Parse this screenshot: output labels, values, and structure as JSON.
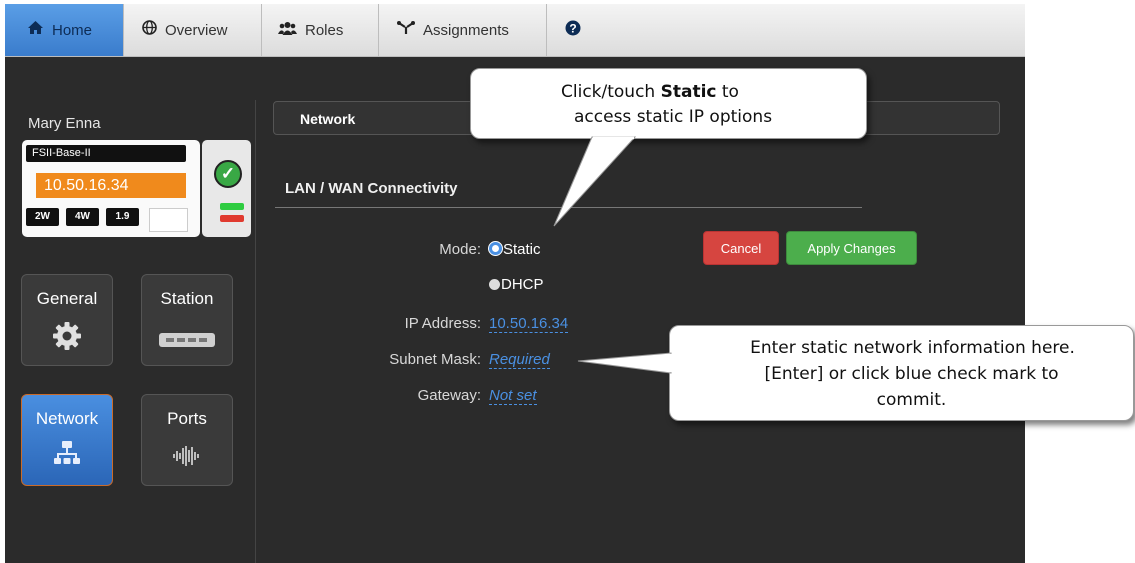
{
  "nav": {
    "tabs": [
      {
        "label": "Home",
        "icon": "home-icon"
      },
      {
        "label": "Overview",
        "icon": "globe-icon"
      },
      {
        "label": "Roles",
        "icon": "users-icon"
      },
      {
        "label": "Assignments",
        "icon": "assignments-icon"
      }
    ],
    "help_icon": "help-icon"
  },
  "sidebar": {
    "user": "Mary Enna",
    "device": {
      "name": "FSII-Base-II",
      "ip": "10.50.16.34",
      "chips": [
        "2W",
        "4W",
        "1.9"
      ]
    },
    "tiles": [
      {
        "label": "General",
        "icon": "gear-icon"
      },
      {
        "label": "Station",
        "icon": "station-icon"
      },
      {
        "label": "Network",
        "icon": "network-icon"
      },
      {
        "label": "Ports",
        "icon": "waveform-icon"
      }
    ]
  },
  "main": {
    "section_title": "Network",
    "subsection": "LAN / WAN Connectivity",
    "mode_label": "Mode:",
    "mode_options": [
      "Static",
      "DHCP"
    ],
    "selected_mode": "Static",
    "ip_label": "IP Address:",
    "ip_value": "10.50.16.34",
    "subnet_label": "Subnet Mask:",
    "subnet_value": "Required",
    "gateway_label": "Gateway:",
    "gateway_value": "Not set",
    "cancel_label": "Cancel",
    "apply_label": "Apply Changes"
  },
  "callouts": {
    "top_pre": "Click/touch ",
    "top_bold": "Static",
    "top_post": " to",
    "top_line2": "access static IP options",
    "right_line1": "Enter static network information here.",
    "right_line2": "[Enter] or click blue check mark to",
    "right_line3": "commit."
  },
  "colors": {
    "accent": "#3a7ccc",
    "ip_orange": "#f08a1c",
    "cancel": "#d9534f",
    "apply": "#4cae4c",
    "link": "#4a90e2"
  }
}
